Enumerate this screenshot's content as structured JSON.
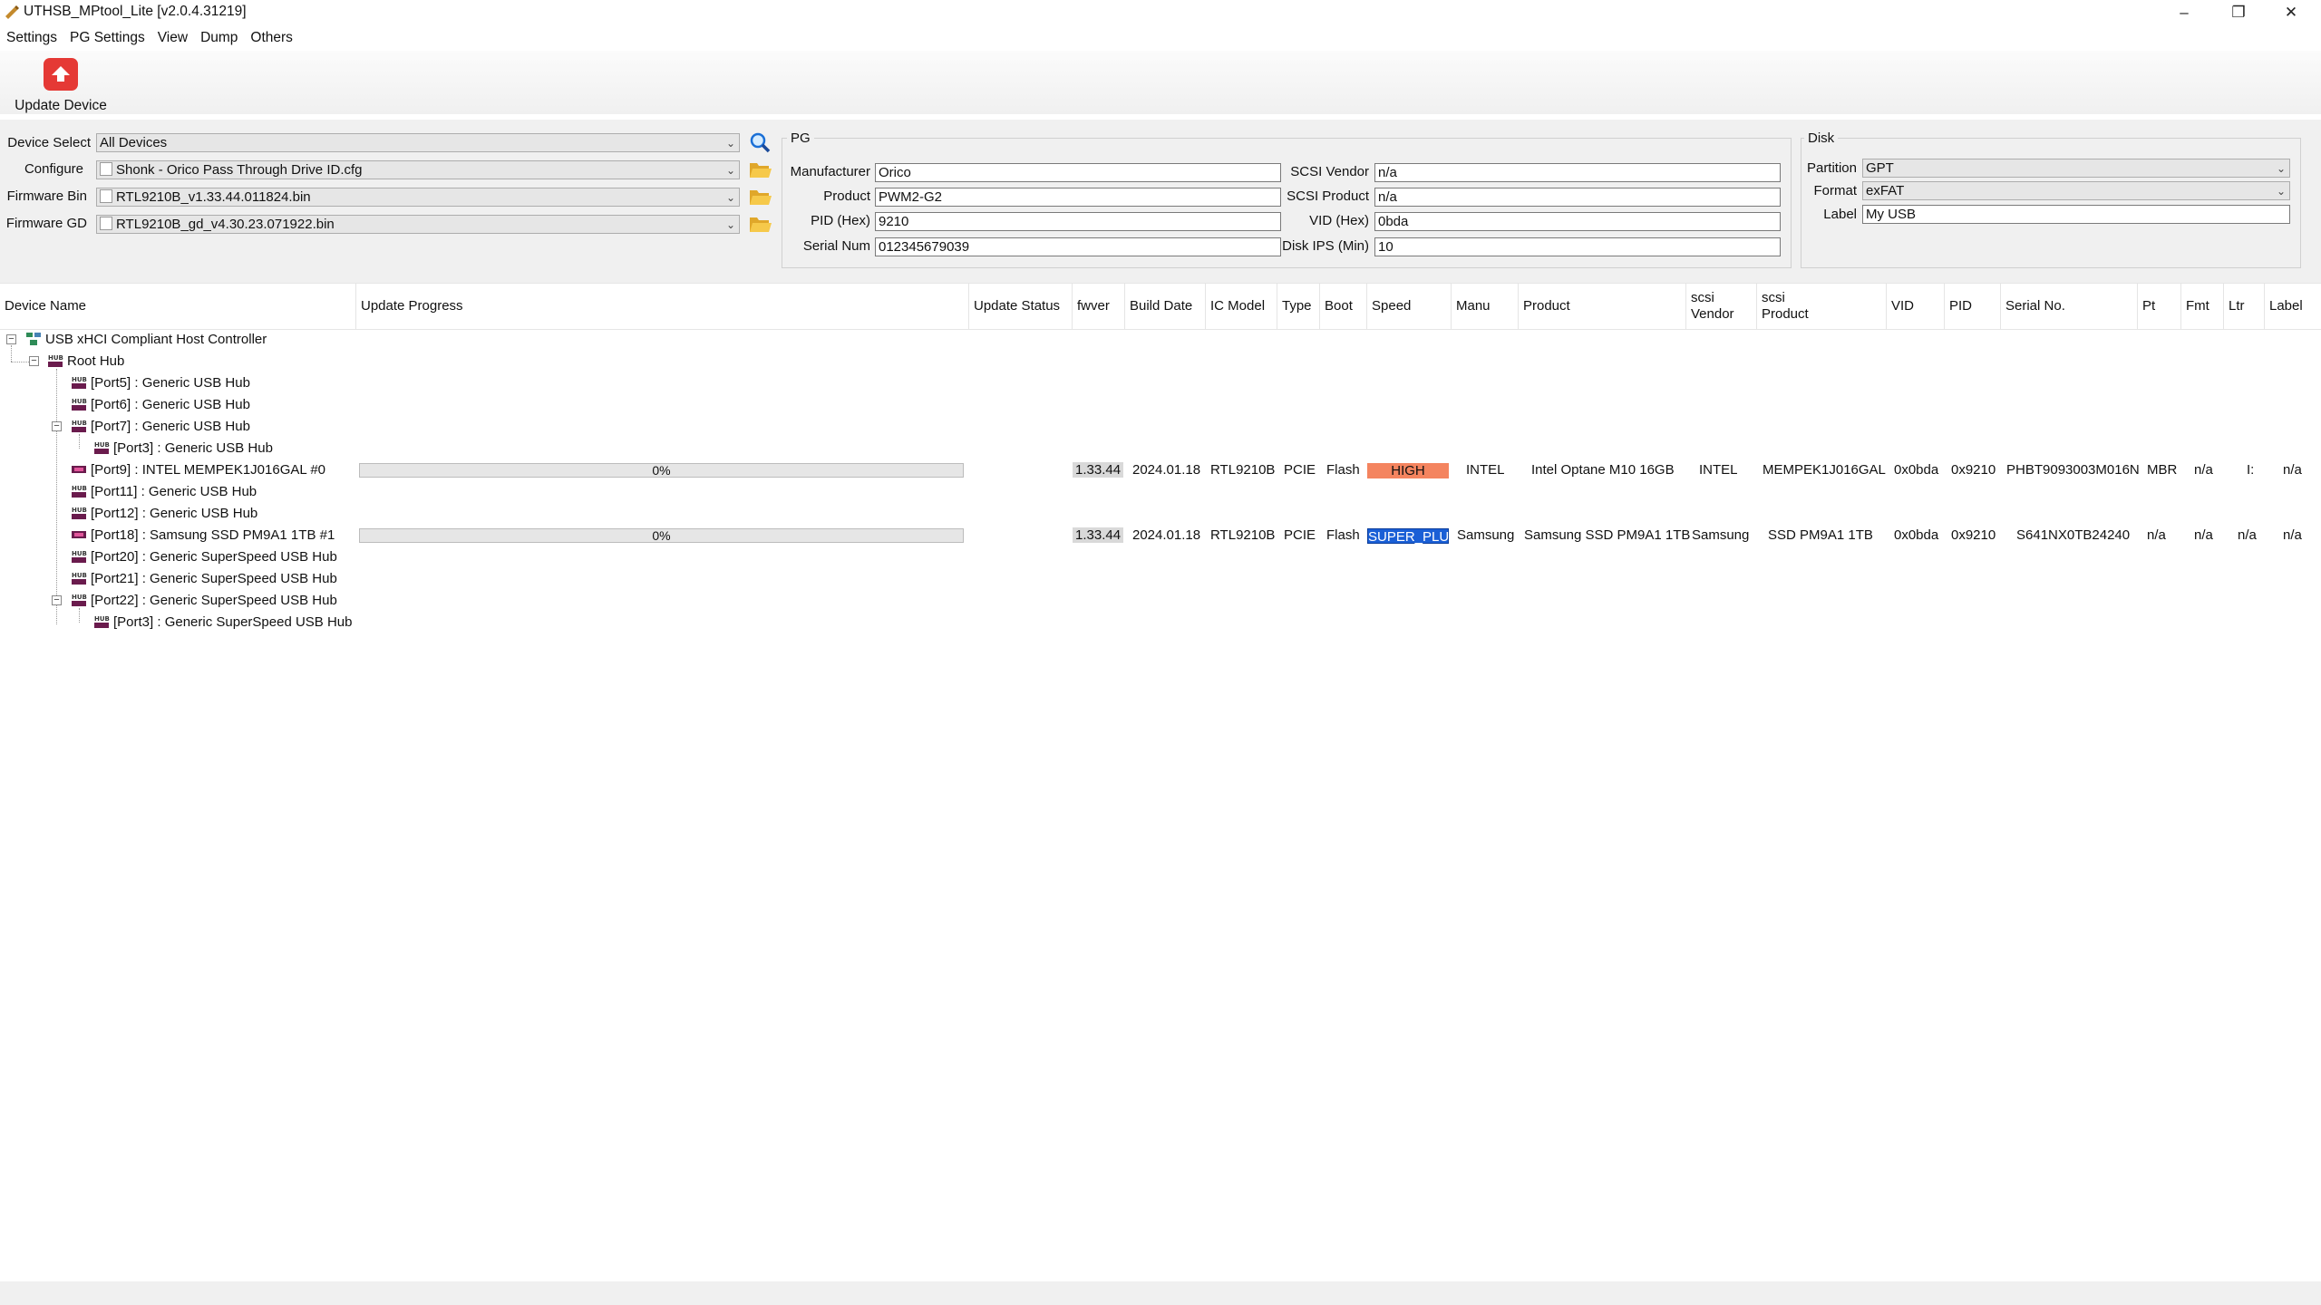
{
  "window": {
    "title": "UTHSB_MPtool_Lite [v2.0.4.31219]"
  },
  "menu": [
    "Settings",
    "PG Settings",
    "View",
    "Dump",
    "Others"
  ],
  "toolbar": {
    "update_label": "Update Device"
  },
  "config": {
    "device_select_label": "Device Select",
    "device_select_value": "All Devices",
    "configure_label": "Configure",
    "configure_value": "Shonk - Orico Pass Through Drive ID.cfg",
    "firmware_bin_label": "Firmware Bin",
    "firmware_bin_value": "RTL9210B_v1.33.44.011824.bin",
    "firmware_gd_label": "Firmware GD",
    "firmware_gd_value": "RTL9210B_gd_v4.30.23.071922.bin"
  },
  "pg": {
    "title": "PG",
    "manufacturer_label": "Manufacturer",
    "manufacturer": "Orico",
    "product_label": "Product",
    "product": "PWM2-G2",
    "pid_label": "PID (Hex)",
    "pid": "9210",
    "serial_label": "Serial Num",
    "serial": "012345679039",
    "scsi_vendor_label": "SCSI Vendor",
    "scsi_vendor": "n/a",
    "scsi_product_label": "SCSI Product",
    "scsi_product": "n/a",
    "vid_label": "VID (Hex)",
    "vid": "0bda",
    "disk_ips_label": "Disk IPS (Min)",
    "disk_ips": "10"
  },
  "disk": {
    "title": "Disk",
    "partition_label": "Partition",
    "partition": "GPT",
    "format_label": "Format",
    "format": "exFAT",
    "label_label": "Label",
    "label": "My USB"
  },
  "columns": {
    "device_name": "Device Name",
    "update_progress": "Update Progress",
    "update_status": "Update Status",
    "fwver": "fwver",
    "build_date": "Build Date",
    "ic_model": "IC Model",
    "type": "Type",
    "boot": "Boot",
    "speed": "Speed",
    "manu": "Manu",
    "product": "Product",
    "scsi_vendor_1": "scsi",
    "scsi_vendor_2": "Vendor",
    "scsi_product_1": "scsi",
    "scsi_product_2": "Product",
    "vid": "VID",
    "pid": "PID",
    "serial_no": "Serial No.",
    "pt": "Pt",
    "fmt": "Fmt",
    "ltr": "Ltr",
    "label": "Label"
  },
  "tree": [
    "USB xHCI Compliant Host Controller",
    "Root Hub",
    "[Port5] : Generic USB Hub",
    "[Port6] : Generic USB Hub",
    "[Port7] : Generic USB Hub",
    "[Port3] : Generic USB Hub",
    "[Port9] : INTEL MEMPEK1J016GAL #0",
    "[Port11] : Generic USB Hub",
    "[Port12] : Generic USB Hub",
    "[Port18] : Samsung SSD PM9A1 1TB #1",
    "[Port20] : Generic SuperSpeed USB Hub",
    "[Port21] : Generic SuperSpeed USB Hub",
    "[Port22] : Generic SuperSpeed USB Hub",
    "[Port3] : Generic SuperSpeed USB Hub"
  ],
  "devices": [
    {
      "progress_label": "0%",
      "progress": 0,
      "fwver": "1.33.44",
      "build_date": "2024.01.18",
      "ic_model": "RTL9210B",
      "type": "PCIE",
      "boot": "Flash",
      "speed": "HIGH",
      "speed_color": "#f4845f",
      "manu": "INTEL",
      "product": "Intel Optane M10 16GB",
      "scsi_vendor": "INTEL",
      "scsi_product": "MEMPEK1J016GAL",
      "vid": "0x0bda",
      "pid": "0x9210",
      "serial": "PHBT9093003M016N",
      "pt": "MBR",
      "fmt": "n/a",
      "ltr": "I:",
      "label": "n/a"
    },
    {
      "progress_label": "0%",
      "progress": 0,
      "fwver": "1.33.44",
      "build_date": "2024.01.18",
      "ic_model": "RTL9210B",
      "type": "PCIE",
      "boot": "Flash",
      "speed": "SUPER_PLUS",
      "speed_color": "#1a5fd6",
      "manu": "Samsung",
      "product": "Samsung SSD PM9A1 1TB",
      "scsi_vendor": "Samsung",
      "scsi_product": "SSD PM9A1 1TB",
      "vid": "0x0bda",
      "pid": "0x9210",
      "serial": "S641NX0TB24240",
      "pt": "n/a",
      "fmt": "n/a",
      "ltr": "n/a",
      "label": "n/a"
    }
  ]
}
